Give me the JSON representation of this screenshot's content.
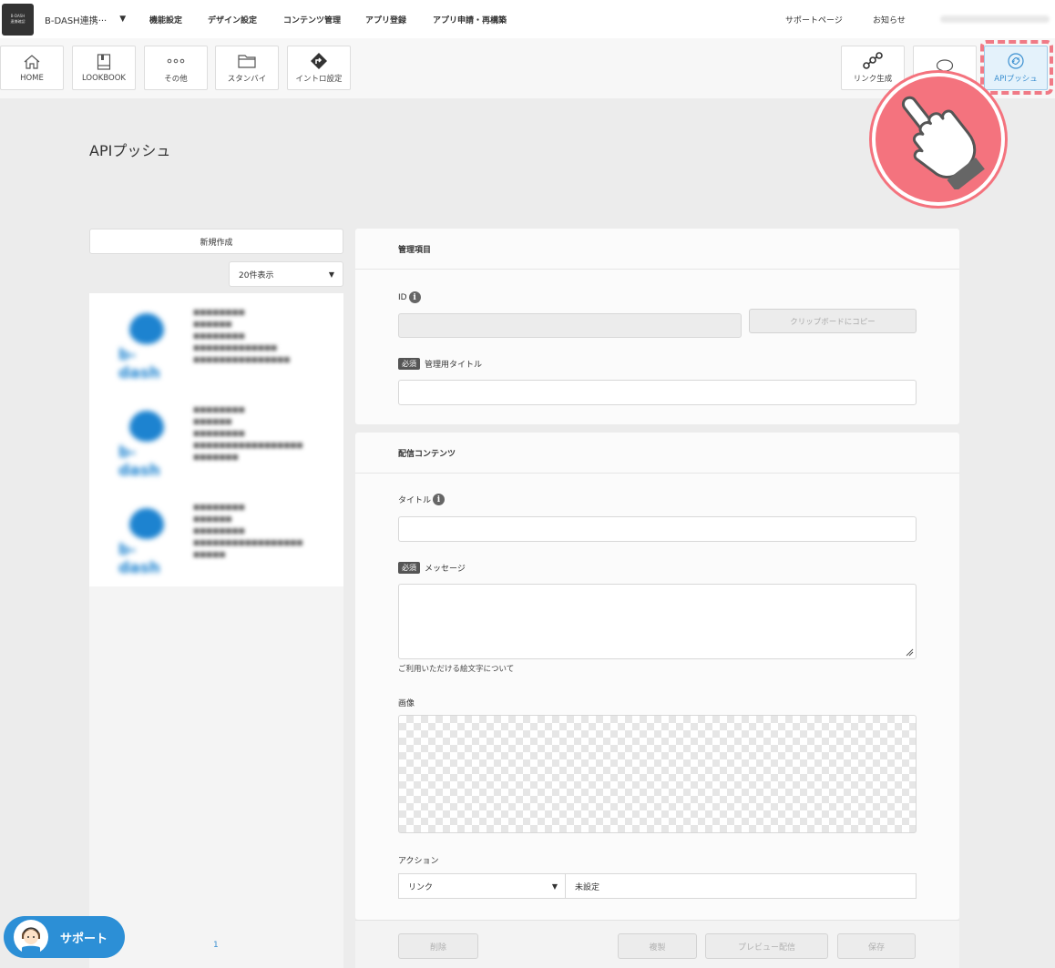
{
  "app": {
    "logo_line1": "B-DASH",
    "logo_line2": "連携確認",
    "name": "B-DASH連携···",
    "caret": "▼"
  },
  "nav": {
    "items": [
      "機能設定",
      "デザイン設定",
      "コンテンツ管理",
      "アプリ登録",
      "アプリ申請・再構築"
    ],
    "support_page": "サポートページ",
    "news": "お知らせ"
  },
  "toolbar": {
    "left": [
      {
        "label": "HOME",
        "icon": "home-icon"
      },
      {
        "label": "LOOKBOOK",
        "icon": "book-icon"
      },
      {
        "label": "その他",
        "icon": "dots-icon"
      },
      {
        "label": "スタンバイ",
        "icon": "folder-icon"
      },
      {
        "label": "イントロ設定",
        "icon": "diamond-arrow-icon"
      }
    ],
    "right": [
      {
        "label": "リンク生成",
        "icon": "link-chain-icon"
      },
      {
        "label": "",
        "icon": "speech-bubble-icon"
      },
      {
        "label": "APIプッシュ",
        "icon": "api-link-icon"
      }
    ]
  },
  "page": {
    "title": "APIプッシュ"
  },
  "list": {
    "new_button": "新規作成",
    "per_page": "20件表示",
    "pager_current": "1"
  },
  "support": {
    "label": "サポート"
  },
  "management": {
    "heading": "管理項目",
    "id_label": "ID",
    "id_value": "",
    "copy_button": "クリップボードにコピー",
    "required_badge": "必須",
    "title_label": "管理用タイトル",
    "title_value": ""
  },
  "content": {
    "heading": "配信コンテンツ",
    "title_label": "タイトル",
    "title_value": "",
    "required_badge": "必須",
    "message_label": "メッセージ",
    "message_value": "",
    "emoji_note": "ご利用いただける絵文字について",
    "image_label": "画像",
    "action_label": "アクション",
    "action_type": "リンク",
    "action_value": "未設定"
  },
  "footer": {
    "delete": "削除",
    "duplicate": "複製",
    "preview": "プレビュー配信",
    "save": "保存"
  },
  "colors": {
    "accent": "#3a8fd0",
    "highlight": "#f07a86",
    "support": "#2c8fd6"
  }
}
